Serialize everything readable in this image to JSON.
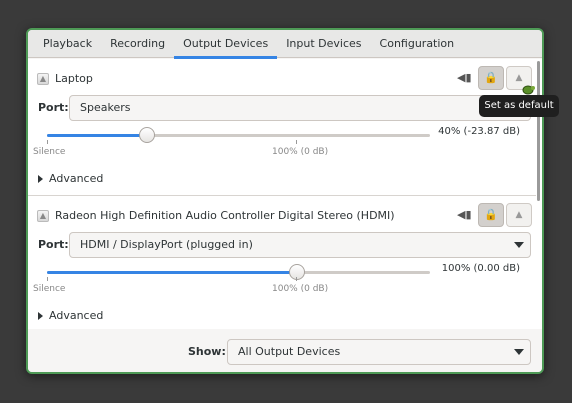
{
  "tabs": [
    "Playback",
    "Recording",
    "Output Devices",
    "Input Devices",
    "Configuration"
  ],
  "devices": [
    {
      "name": "Laptop",
      "port_label": "Port:",
      "port_value": "Speakers",
      "volume_fraction": 0.4,
      "volume_text": "40% (-23.87 dB)",
      "silence_mark": "Silence",
      "full_mark": "100% (0 dB)",
      "advanced_label": "Advanced"
    },
    {
      "name": "Radeon High Definition Audio Controller Digital Stereo (HDMI)",
      "port_label": "Port:",
      "port_value": "HDMI / DisplayPort (plugged in)",
      "volume_fraction": 1.0,
      "volume_text": "100% (0.00 dB)",
      "silence_mark": "Silence",
      "full_mark": "100% (0 dB)",
      "advanced_label": "Advanced"
    }
  ],
  "show": {
    "label": "Show:",
    "value": "All Output Devices"
  },
  "tooltip": "Set as default",
  "icons": {
    "device": "audio-card-icon",
    "mute": "speaker-mute-icon",
    "lock": "lock-channels-icon",
    "default": "set-default-icon",
    "cursor": "turtle-cursor-icon"
  },
  "colors": {
    "accent": "#3584e4",
    "window_border": "#4e9a56",
    "tooltip_bg": "#1f1f1f"
  }
}
